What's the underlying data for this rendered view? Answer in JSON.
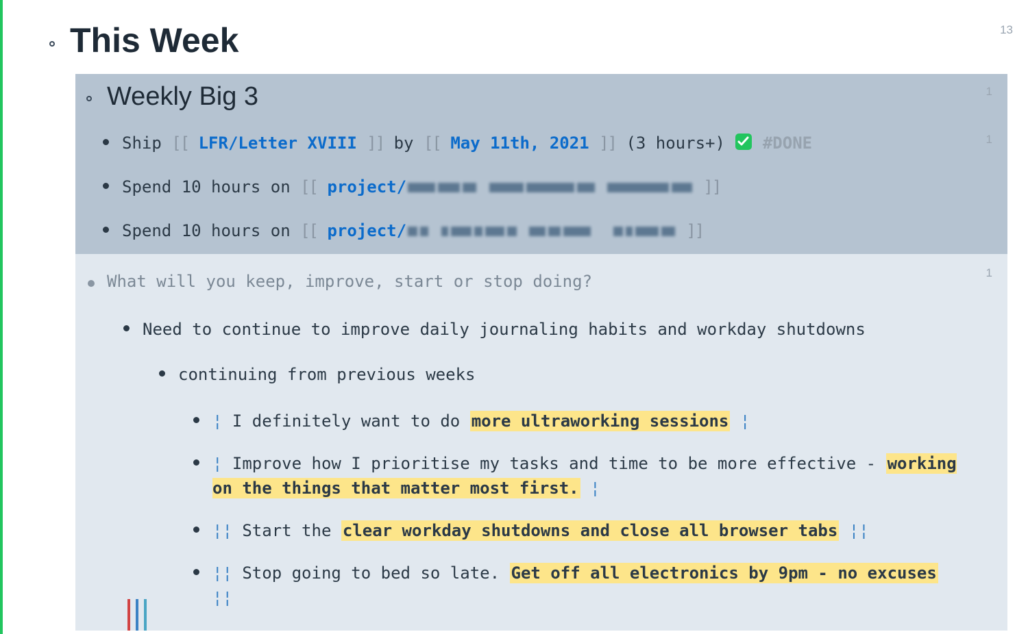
{
  "page": {
    "top_ref_count": "13",
    "title": "This Week"
  },
  "big3": {
    "heading": "Weekly Big 3",
    "ref_count_heading": "1",
    "ref_count_item1": "1",
    "items": [
      {
        "prefix": "Ship ",
        "link1": "LFR/Letter XVIII",
        "mid": " by ",
        "link2": "May 11th, 2021",
        "suffix": " (3 hours+) ",
        "done_tag": "#DONE",
        "has_check": true
      },
      {
        "prefix": "Spend 10 hours on ",
        "link1": "project/",
        "redacted": true
      },
      {
        "prefix": "Spend 10 hours on ",
        "link1": "project/",
        "redacted": true
      }
    ]
  },
  "reflect": {
    "question": "What will you keep, improve, start or stop doing?",
    "ref_count": "1",
    "line1": "Need to continue to improve daily journaling habits and workday shutdowns",
    "line2": "continuing from previous weeks",
    "nested": [
      {
        "pre": "I definitely want to do ",
        "hl": "more ultraworking sessions",
        "post": ""
      },
      {
        "pre": "Improve how I prioritise my tasks and time to be more effective - ",
        "hl": "working on the things that matter most first.",
        "post": ""
      },
      {
        "pre": "Start the ",
        "hl": "clear workday shutdowns and close all browser tabs",
        "post": ""
      },
      {
        "pre": "Stop going to bed so late. ",
        "hl": "Get off all electronics by 9pm - no excuses",
        "post": ""
      }
    ]
  },
  "brackets": {
    "open": "[[",
    "close": "]]"
  },
  "ref_markers": {
    "single": "¦",
    "double": "¦¦"
  }
}
